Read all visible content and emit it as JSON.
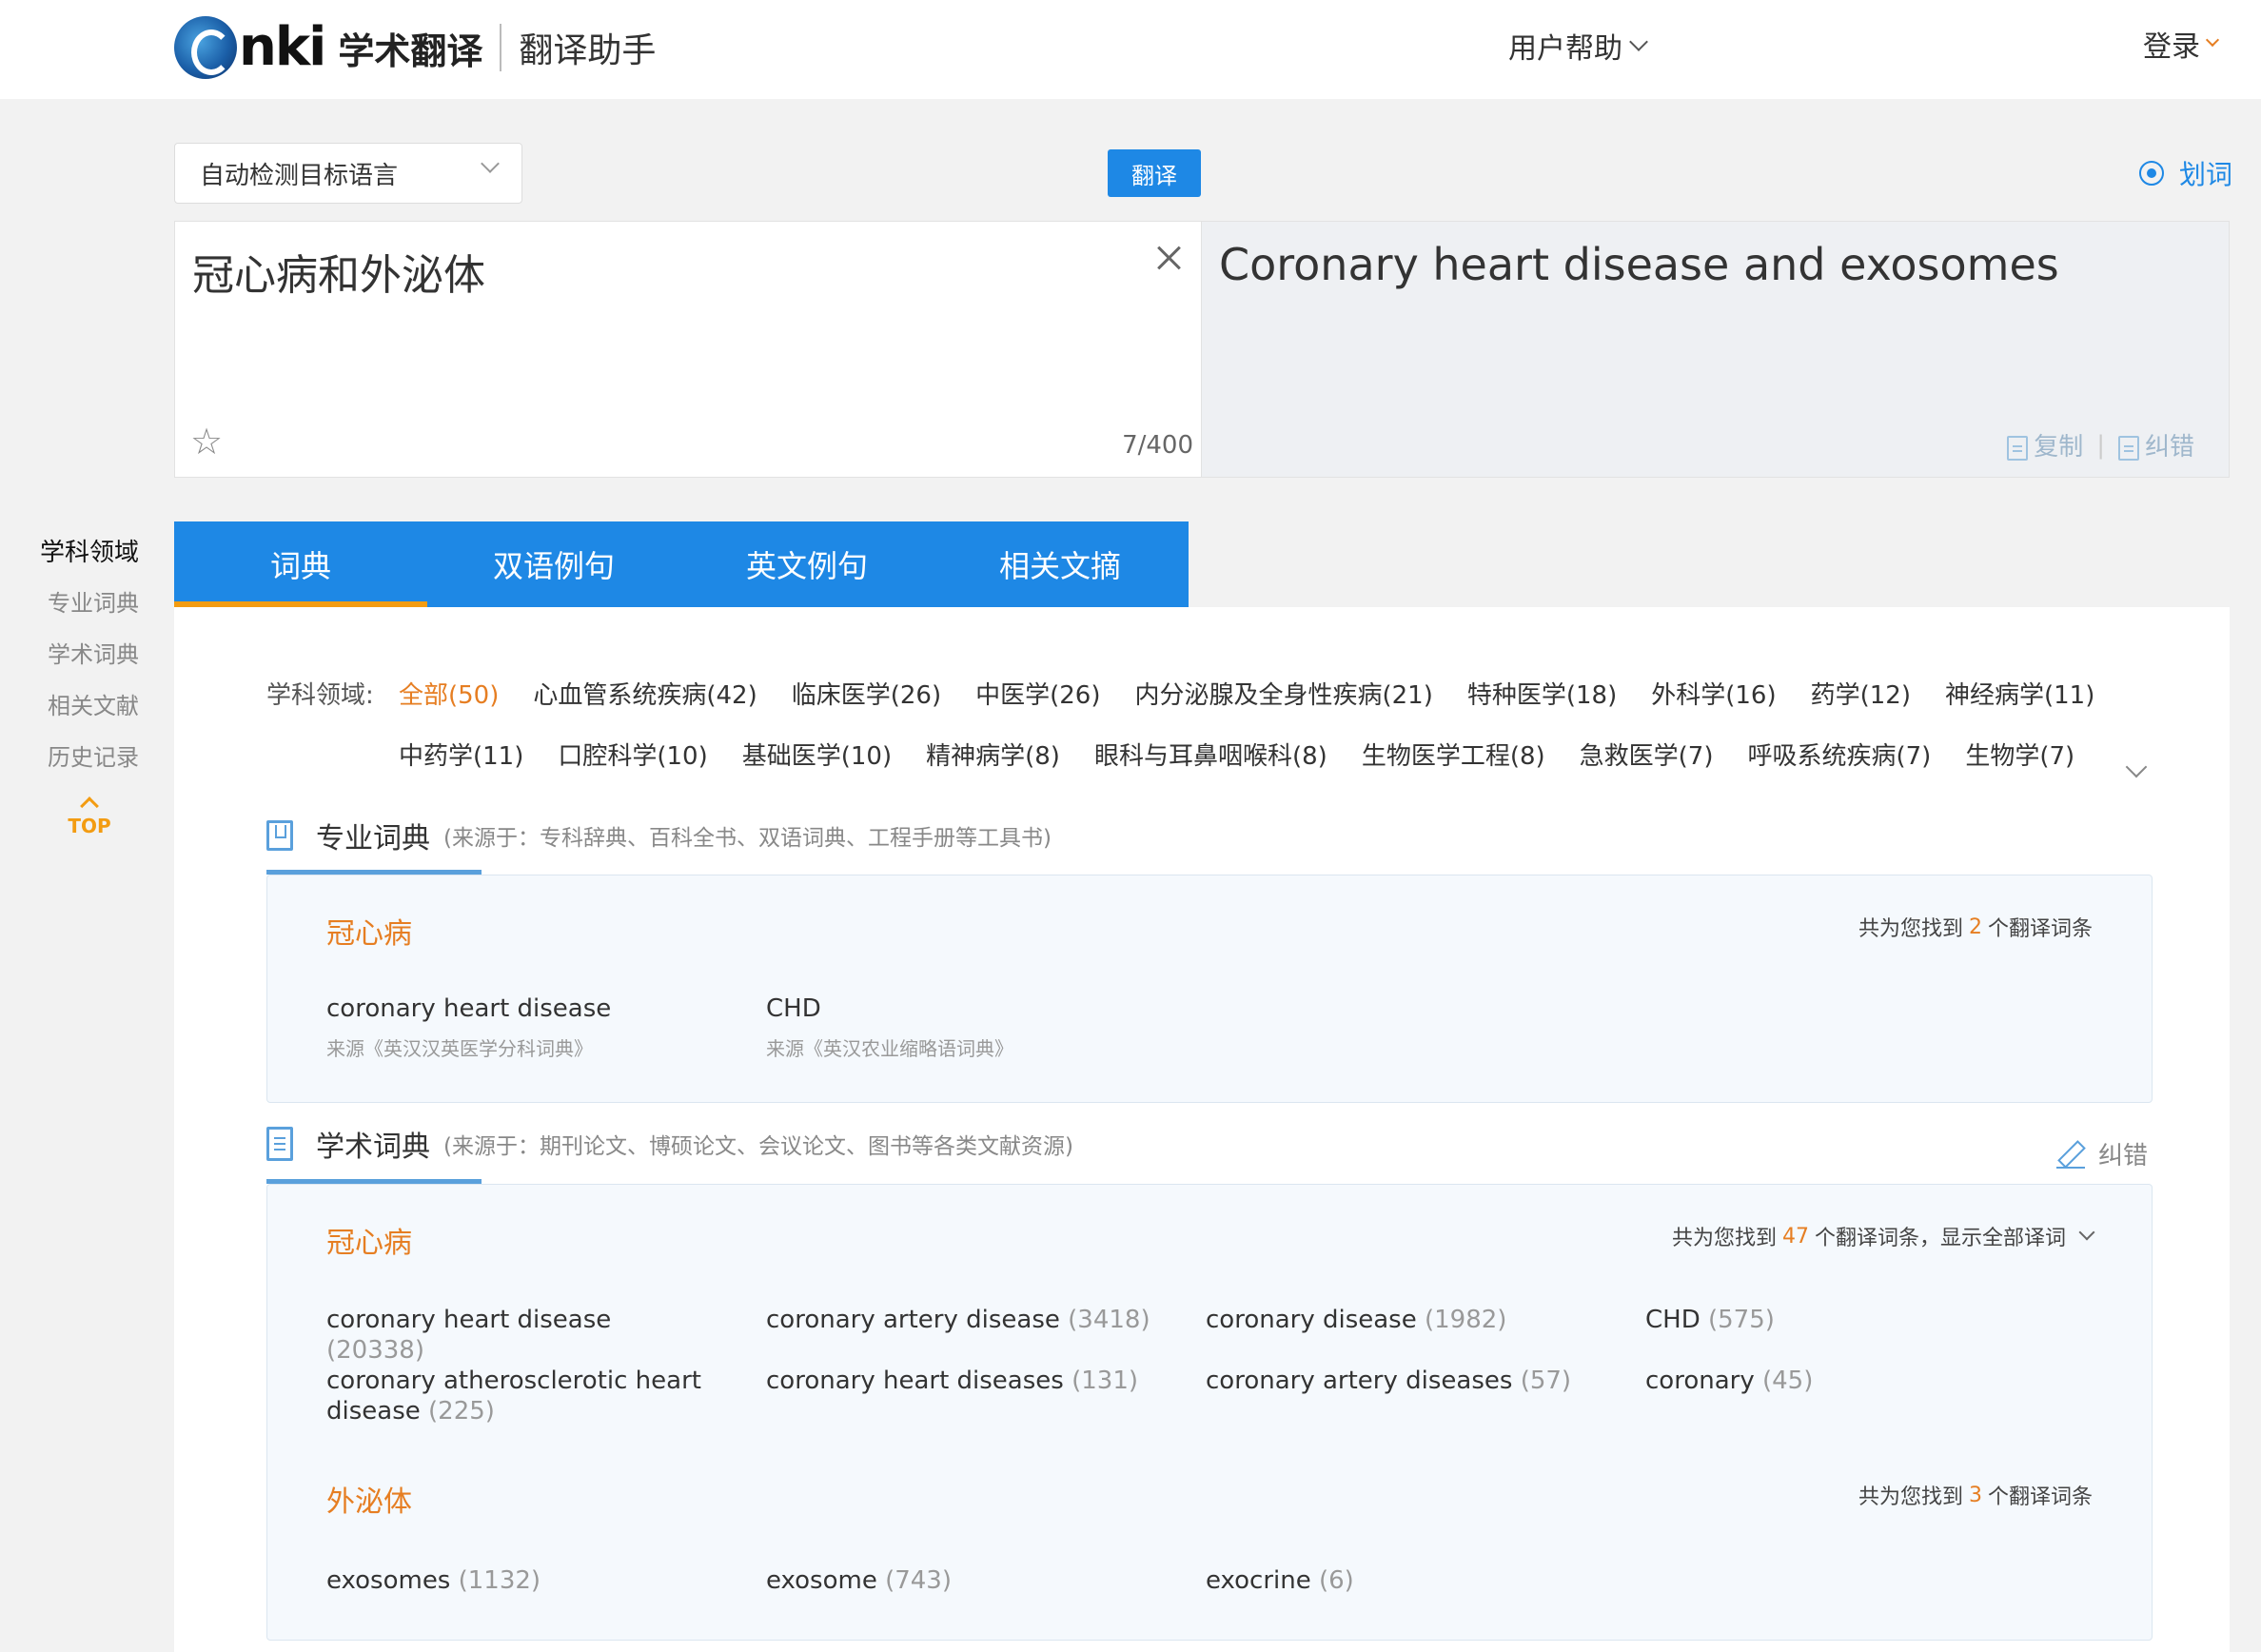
{
  "header": {
    "logo_brand": "nki",
    "logo_cn": "学术翻译",
    "assistant": "翻译助手",
    "help_menu": "用户帮助",
    "login": "登录"
  },
  "toolbar": {
    "target_language": "自动检测目标语言",
    "translate_button": "翻译",
    "word_pick": "划词"
  },
  "source": {
    "text": "冠心病和外泌体",
    "char_count": "7/400"
  },
  "target": {
    "text": "Coronary heart disease and exosomes",
    "copy": "复制",
    "correct": "纠错"
  },
  "left_nav": {
    "title": "学科领域",
    "items": [
      "专业词典",
      "学术词典",
      "相关文献",
      "历史记录"
    ],
    "top": "TOP"
  },
  "tabs": [
    "词典",
    "双语例句",
    "英文例句",
    "相关文摘"
  ],
  "subjects": {
    "label": "学科领域:",
    "row1": [
      "全部(50)",
      "心血管系统疾病(42)",
      "临床医学(26)",
      "中医学(26)",
      "内分泌腺及全身性疾病(21)",
      "特种医学(18)",
      "外科学(16)",
      "药学(12)",
      "神经病学(11)"
    ],
    "row2": [
      "中药学(11)",
      "口腔科学(10)",
      "基础医学(10)",
      "精神病学(8)",
      "眼科与耳鼻咽喉科(8)",
      "生物医学工程(8)",
      "急救医学(7)",
      "呼吸系统疾病(7)",
      "生物学(7)"
    ]
  },
  "pro_dict": {
    "title": "专业词典",
    "source_note": "(来源于：专科辞典、百科全书、双语词典、工程手册等工具书)",
    "term": "冠心病",
    "found_pre": "共为您找到",
    "found_num": "2",
    "found_post": "个翻译词条",
    "entries": [
      {
        "text": "coronary heart disease",
        "src": "来源《英汉汉英医学分科词典》"
      },
      {
        "text": "CHD",
        "src": "来源《英汉农业缩略语词典》"
      }
    ]
  },
  "acad_dict": {
    "title": "学术词典",
    "source_note": "(来源于：期刊论文、博硕论文、会议论文、图书等各类文献资源)",
    "correct": "纠错",
    "groups": [
      {
        "term": "冠心病",
        "found_pre": "共为您找到",
        "found_num": "47",
        "found_post": "个翻译词条，显示全部译词",
        "entries": [
          {
            "text": "coronary heart disease",
            "count": "(20338)"
          },
          {
            "text": "coronary artery disease",
            "count": "(3418)"
          },
          {
            "text": "coronary disease",
            "count": "(1982)"
          },
          {
            "text": "CHD",
            "count": "(575)"
          },
          {
            "text": "coronary atherosclerotic heart disease",
            "count": "(225)"
          },
          {
            "text": "coronary heart diseases",
            "count": "(131)"
          },
          {
            "text": "coronary artery diseases",
            "count": "(57)"
          },
          {
            "text": "coronary",
            "count": "(45)"
          }
        ]
      },
      {
        "term": "外泌体",
        "found_pre": "共为您找到",
        "found_num": "3",
        "found_post": "个翻译词条",
        "entries": [
          {
            "text": "exosomes",
            "count": "(1132)"
          },
          {
            "text": "exosome",
            "count": "(743)"
          },
          {
            "text": "exocrine",
            "count": "(6)"
          }
        ]
      }
    ]
  }
}
